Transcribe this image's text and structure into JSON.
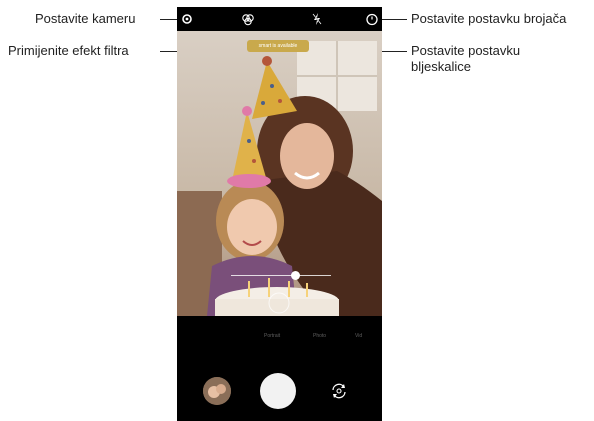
{
  "callouts": {
    "settings": "Postavite kameru",
    "filter": "Primijenite efekt filtra",
    "timer": "Postavite postavku brojača",
    "flash_line1": "Postavite postavku",
    "flash_line2": "bljeskalice"
  },
  "camera": {
    "hint_text": "smart is available",
    "zoom_level": 0.64,
    "modes": [
      "Portrait",
      "Photo",
      "Vid"
    ],
    "icons": {
      "settings": "gear-icon",
      "filter": "filter-icon",
      "flash": "flash-off-icon",
      "timer": "timer-icon",
      "gallery": "gallery-thumbnail",
      "shutter": "shutter-button",
      "switch": "switch-camera-icon"
    }
  }
}
